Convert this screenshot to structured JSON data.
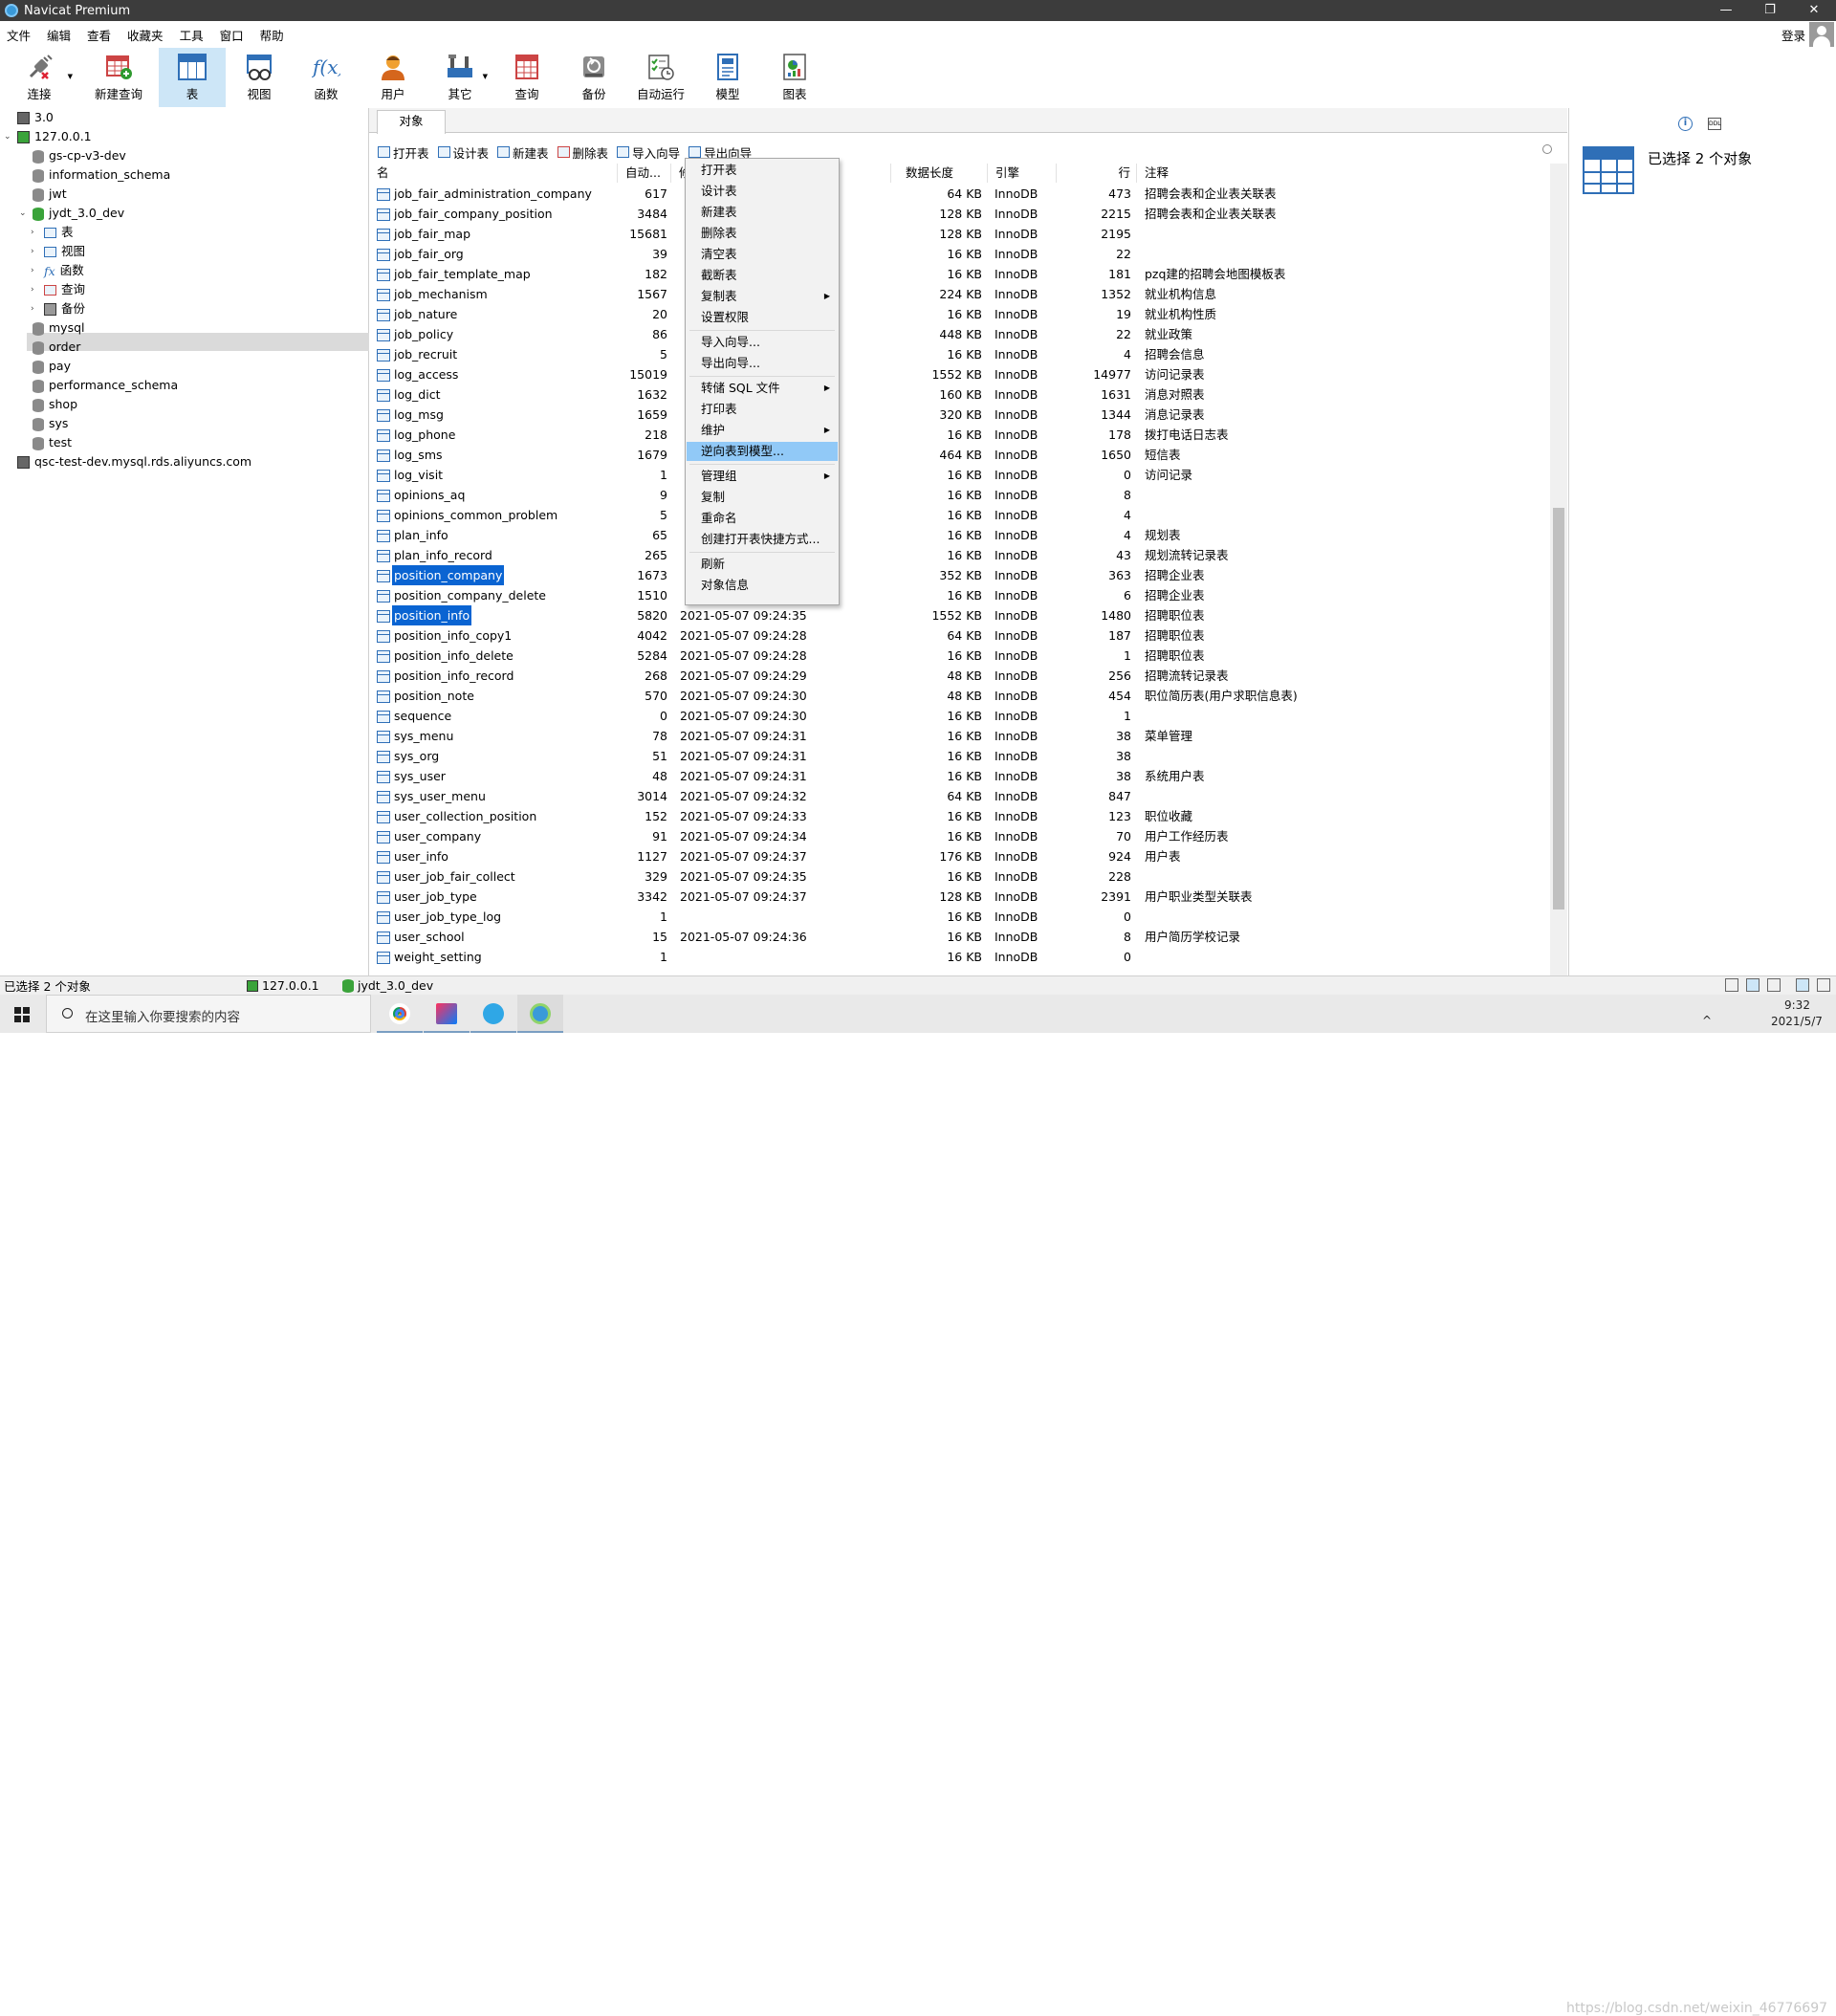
{
  "window": {
    "title": "Navicat Premium",
    "min": "—",
    "max": "❐",
    "close": "✕"
  },
  "menu": [
    "文件",
    "编辑",
    "查看",
    "收藏夹",
    "工具",
    "窗口",
    "帮助"
  ],
  "login_label": "登录",
  "toolbar": [
    {
      "label": "连接",
      "icon": "plug-icon"
    },
    {
      "label": "新建查询",
      "icon": "new-query-icon"
    },
    {
      "label": "表",
      "icon": "table-icon",
      "active": true
    },
    {
      "label": "视图",
      "icon": "view-icon"
    },
    {
      "label": "函数",
      "icon": "function-icon"
    },
    {
      "label": "用户",
      "icon": "user-icon"
    },
    {
      "label": "其它",
      "icon": "tools-icon"
    },
    {
      "label": "查询",
      "icon": "query-icon"
    },
    {
      "label": "备份",
      "icon": "backup-icon"
    },
    {
      "label": "自动运行",
      "icon": "schedule-icon"
    },
    {
      "label": "模型",
      "icon": "model-icon"
    },
    {
      "label": "图表",
      "icon": "chart-icon"
    }
  ],
  "sidebar": {
    "connections": [
      {
        "label": "3.0"
      },
      {
        "label": "127.0.0.1"
      },
      {
        "label": "qsc-test-dev.mysql.rds.aliyuncs.com"
      }
    ],
    "databases": [
      "gs-cp-v3-dev",
      "information_schema",
      "jwt",
      "jydt_3.0_dev",
      "mysql",
      "order",
      "pay",
      "performance_schema",
      "shop",
      "sys",
      "test"
    ],
    "objects": [
      "表",
      "视图",
      "函数",
      "查询",
      "备份"
    ]
  },
  "tab_label": "对象",
  "objbar": [
    "打开表",
    "设计表",
    "新建表",
    "删除表",
    "导入向导",
    "导出向导"
  ],
  "columns": {
    "name": "名",
    "auto": "自动...",
    "modified": "修改日期",
    "length": "数据长度",
    "engine": "引擎",
    "rows": "行",
    "comment": "注释"
  },
  "rows": [
    {
      "name": "job_fair_administration_company",
      "auto": "617",
      "mod": "",
      "len": "64 KB",
      "eng": "InnoDB",
      "rows": "473",
      "cmt": "招聘会表和企业表关联表"
    },
    {
      "name": "job_fair_company_position",
      "auto": "3484",
      "mod": "",
      "len": "128 KB",
      "eng": "InnoDB",
      "rows": "2215",
      "cmt": "招聘会表和企业表关联表"
    },
    {
      "name": "job_fair_map",
      "auto": "15681",
      "mod": "",
      "len": "128 KB",
      "eng": "InnoDB",
      "rows": "2195",
      "cmt": ""
    },
    {
      "name": "job_fair_org",
      "auto": "39",
      "mod": "",
      "len": "16 KB",
      "eng": "InnoDB",
      "rows": "22",
      "cmt": ""
    },
    {
      "name": "job_fair_template_map",
      "auto": "182",
      "mod": "",
      "len": "16 KB",
      "eng": "InnoDB",
      "rows": "181",
      "cmt": "pzq建的招聘会地图模板表"
    },
    {
      "name": "job_mechanism",
      "auto": "1567",
      "mod": "",
      "len": "224 KB",
      "eng": "InnoDB",
      "rows": "1352",
      "cmt": "就业机构信息"
    },
    {
      "name": "job_nature",
      "auto": "20",
      "mod": "",
      "len": "16 KB",
      "eng": "InnoDB",
      "rows": "19",
      "cmt": "就业机构性质"
    },
    {
      "name": "job_policy",
      "auto": "86",
      "mod": "",
      "len": "448 KB",
      "eng": "InnoDB",
      "rows": "22",
      "cmt": "就业政策"
    },
    {
      "name": "job_recruit",
      "auto": "5",
      "mod": "",
      "len": "16 KB",
      "eng": "InnoDB",
      "rows": "4",
      "cmt": "招聘会信息"
    },
    {
      "name": "log_access",
      "auto": "15019",
      "mod": "",
      "len": "1552 KB",
      "eng": "InnoDB",
      "rows": "14977",
      "cmt": "访问记录表"
    },
    {
      "name": "log_dict",
      "auto": "1632",
      "mod": "",
      "len": "160 KB",
      "eng": "InnoDB",
      "rows": "1631",
      "cmt": "消息对照表"
    },
    {
      "name": "log_msg",
      "auto": "1659",
      "mod": "",
      "len": "320 KB",
      "eng": "InnoDB",
      "rows": "1344",
      "cmt": "消息记录表"
    },
    {
      "name": "log_phone",
      "auto": "218",
      "mod": "",
      "len": "16 KB",
      "eng": "InnoDB",
      "rows": "178",
      "cmt": "拨打电话日志表"
    },
    {
      "name": "log_sms",
      "auto": "1679",
      "mod": "",
      "len": "464 KB",
      "eng": "InnoDB",
      "rows": "1650",
      "cmt": "短信表"
    },
    {
      "name": "log_visit",
      "auto": "1",
      "mod": "",
      "len": "16 KB",
      "eng": "InnoDB",
      "rows": "0",
      "cmt": "访问记录"
    },
    {
      "name": "opinions_aq",
      "auto": "9",
      "mod": "",
      "len": "16 KB",
      "eng": "InnoDB",
      "rows": "8",
      "cmt": ""
    },
    {
      "name": "opinions_common_problem",
      "auto": "5",
      "mod": "",
      "len": "16 KB",
      "eng": "InnoDB",
      "rows": "4",
      "cmt": ""
    },
    {
      "name": "plan_info",
      "auto": "65",
      "mod": "",
      "len": "16 KB",
      "eng": "InnoDB",
      "rows": "4",
      "cmt": "规划表"
    },
    {
      "name": "plan_info_record",
      "auto": "265",
      "mod": "",
      "len": "16 KB",
      "eng": "InnoDB",
      "rows": "43",
      "cmt": "规划流转记录表"
    },
    {
      "name": "position_company",
      "auto": "1673",
      "mod": "",
      "len": "352 KB",
      "eng": "InnoDB",
      "rows": "363",
      "cmt": "招聘企业表",
      "sel": true
    },
    {
      "name": "position_company_delete",
      "auto": "1510",
      "mod": "",
      "len": "16 KB",
      "eng": "InnoDB",
      "rows": "6",
      "cmt": "招聘企业表"
    },
    {
      "name": "position_info",
      "auto": "5820",
      "mod": "2021-05-07 09:24:35",
      "len": "1552 KB",
      "eng": "InnoDB",
      "rows": "1480",
      "cmt": "招聘职位表",
      "sel": true
    },
    {
      "name": "position_info_copy1",
      "auto": "4042",
      "mod": "2021-05-07 09:24:28",
      "len": "64 KB",
      "eng": "InnoDB",
      "rows": "187",
      "cmt": "招聘职位表"
    },
    {
      "name": "position_info_delete",
      "auto": "5284",
      "mod": "2021-05-07 09:24:28",
      "len": "16 KB",
      "eng": "InnoDB",
      "rows": "1",
      "cmt": "招聘职位表"
    },
    {
      "name": "position_info_record",
      "auto": "268",
      "mod": "2021-05-07 09:24:29",
      "len": "48 KB",
      "eng": "InnoDB",
      "rows": "256",
      "cmt": "招聘流转记录表"
    },
    {
      "name": "position_note",
      "auto": "570",
      "mod": "2021-05-07 09:24:30",
      "len": "48 KB",
      "eng": "InnoDB",
      "rows": "454",
      "cmt": "职位简历表(用户求职信息表)"
    },
    {
      "name": "sequence",
      "auto": "0",
      "mod": "2021-05-07 09:24:30",
      "len": "16 KB",
      "eng": "InnoDB",
      "rows": "1",
      "cmt": ""
    },
    {
      "name": "sys_menu",
      "auto": "78",
      "mod": "2021-05-07 09:24:31",
      "len": "16 KB",
      "eng": "InnoDB",
      "rows": "38",
      "cmt": "菜单管理"
    },
    {
      "name": "sys_org",
      "auto": "51",
      "mod": "2021-05-07 09:24:31",
      "len": "16 KB",
      "eng": "InnoDB",
      "rows": "38",
      "cmt": ""
    },
    {
      "name": "sys_user",
      "auto": "48",
      "mod": "2021-05-07 09:24:31",
      "len": "16 KB",
      "eng": "InnoDB",
      "rows": "38",
      "cmt": "系统用户表"
    },
    {
      "name": "sys_user_menu",
      "auto": "3014",
      "mod": "2021-05-07 09:24:32",
      "len": "64 KB",
      "eng": "InnoDB",
      "rows": "847",
      "cmt": ""
    },
    {
      "name": "user_collection_position",
      "auto": "152",
      "mod": "2021-05-07 09:24:33",
      "len": "16 KB",
      "eng": "InnoDB",
      "rows": "123",
      "cmt": "职位收藏"
    },
    {
      "name": "user_company",
      "auto": "91",
      "mod": "2021-05-07 09:24:34",
      "len": "16 KB",
      "eng": "InnoDB",
      "rows": "70",
      "cmt": "用户工作经历表"
    },
    {
      "name": "user_info",
      "auto": "1127",
      "mod": "2021-05-07 09:24:37",
      "len": "176 KB",
      "eng": "InnoDB",
      "rows": "924",
      "cmt": "用户表"
    },
    {
      "name": "user_job_fair_collect",
      "auto": "329",
      "mod": "2021-05-07 09:24:35",
      "len": "16 KB",
      "eng": "InnoDB",
      "rows": "228",
      "cmt": ""
    },
    {
      "name": "user_job_type",
      "auto": "3342",
      "mod": "2021-05-07 09:24:37",
      "len": "128 KB",
      "eng": "InnoDB",
      "rows": "2391",
      "cmt": "用户职业类型关联表"
    },
    {
      "name": "user_job_type_log",
      "auto": "1",
      "mod": "",
      "len": "16 KB",
      "eng": "InnoDB",
      "rows": "0",
      "cmt": ""
    },
    {
      "name": "user_school",
      "auto": "15",
      "mod": "2021-05-07 09:24:36",
      "len": "16 KB",
      "eng": "InnoDB",
      "rows": "8",
      "cmt": "用户简历学校记录"
    },
    {
      "name": "weight_setting",
      "auto": "1",
      "mod": "",
      "len": "16 KB",
      "eng": "InnoDB",
      "rows": "0",
      "cmt": ""
    }
  ],
  "context_menu": [
    {
      "label": "打开表"
    },
    {
      "label": "设计表"
    },
    {
      "label": "新建表"
    },
    {
      "label": "删除表"
    },
    {
      "label": "清空表"
    },
    {
      "label": "截断表"
    },
    {
      "label": "复制表",
      "sub": true
    },
    {
      "label": "设置权限"
    },
    {
      "sep": true
    },
    {
      "label": "导入向导..."
    },
    {
      "label": "导出向导..."
    },
    {
      "sep": true
    },
    {
      "label": "转储 SQL 文件",
      "sub": true
    },
    {
      "label": "打印表"
    },
    {
      "label": "维护",
      "sub": true
    },
    {
      "label": "逆向表到模型...",
      "highlight": true
    },
    {
      "sep": true
    },
    {
      "label": "管理组",
      "sub": true
    },
    {
      "label": "复制"
    },
    {
      "label": "重命名"
    },
    {
      "label": "创建打开表快捷方式..."
    },
    {
      "sep": true
    },
    {
      "label": "刷新"
    },
    {
      "label": "对象信息"
    }
  ],
  "right_panel": {
    "selected_text": "已选择 2 个对象",
    "info_icon": "i",
    "ddl_icon": "DDL"
  },
  "status": {
    "selected": "已选择 2 个对象",
    "connection": "127.0.0.1",
    "database": "jydt_3.0_dev"
  },
  "taskbar": {
    "search_placeholder": "在这里输入你要搜索的内容",
    "time": "9:32",
    "date": "2021/5/7"
  },
  "watermark": "https://blog.csdn.net/weixin_46776697"
}
